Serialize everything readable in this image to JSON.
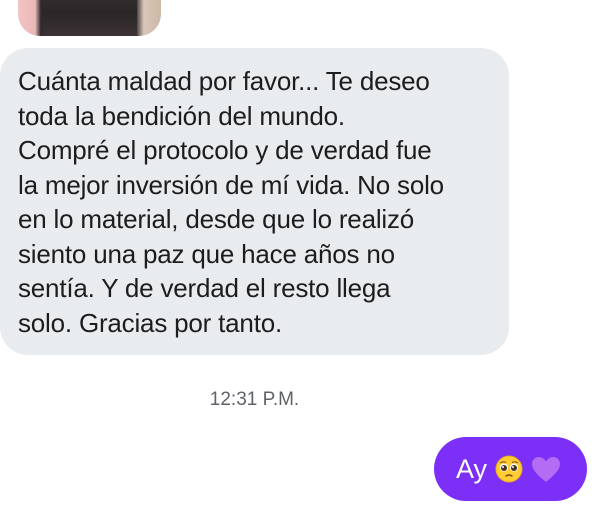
{
  "conversation": {
    "received_message": {
      "text": "Cuánta maldad por favor... Te deseo\ntoda la bendición del mundo.\nCompré el protocolo y de verdad fue\nla mejor inversión de mí vida. No solo\nen lo material, desde que lo realizó\nsiento una paz que hace años no\nsentía. Y de verdad el resto llega\nsolo. Gracias por tanto."
    },
    "timestamp": "12:31 P.M.",
    "sent_message": {
      "text": "Ay",
      "emojis": [
        "pleading-face",
        "purple-heart"
      ]
    }
  },
  "colors": {
    "received_bubble": "#e9ecef",
    "sent_bubble": "#7b2ff7",
    "timestamp_text": "#5f6368",
    "heart": "#b56cf5"
  }
}
